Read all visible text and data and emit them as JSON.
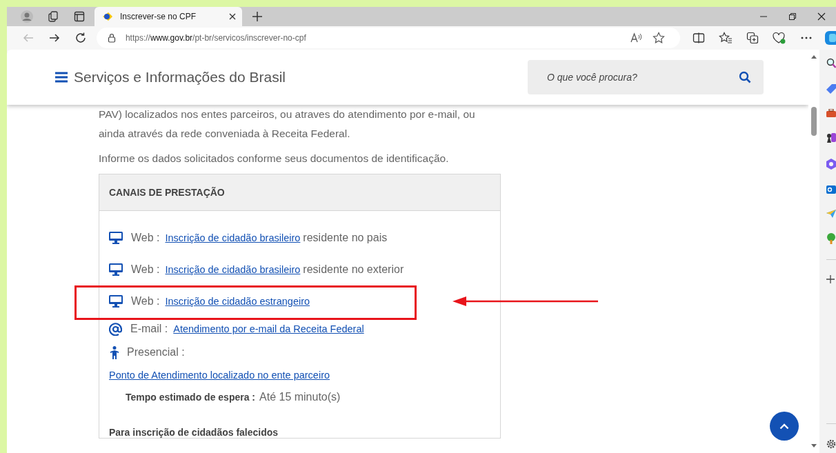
{
  "browser": {
    "tabs": [
      {
        "title": "Inscrever-se no CPF",
        "selected": true
      }
    ],
    "url": {
      "scheme": "https://",
      "host": "www.gov.br",
      "path": "/pt-br/servicos/inscrever-no-cpf"
    }
  },
  "header": {
    "title": "Serviços e Informações do Brasil",
    "search": {
      "placeholder": "O que você procura?"
    }
  },
  "paragraphs": [
    "PAV) localizados nos entes parceiros, ou atraves do atendimento por e-mail, ou ainda através da rede conveniada à Receita Federal.",
    "Informe os dados solicitados conforme seus documentos de identificação."
  ],
  "card": {
    "title": "CANAIS DE PRESTAÇÃO",
    "channels": [
      {
        "kind": "web",
        "label": "Web :",
        "link": "Inscrição de cidadão brasileiro",
        "suffix": "residente no pais"
      },
      {
        "kind": "web",
        "label": "Web :",
        "link": "Inscrição de cidadão brasileiro",
        "suffix": "residente no exterior"
      },
      {
        "kind": "web",
        "label": "Web :",
        "link": "Inscrição de cidadão estrangeiro",
        "annotation": {
          "kind": "frame_with_arrow"
        }
      },
      {
        "kind": "email",
        "label": "E-mail :",
        "link": "Atendimento por e-mail da Receita Federal"
      },
      {
        "kind": "person",
        "label": "Presencial :"
      }
    ],
    "in_person_link": "Ponto de Atendimento localizado no ente parceiro",
    "wait": {
      "label": "Tempo estimado de espera :",
      "value": "Até 15 minuto(s)"
    },
    "footer_heading": "Para inscrição de cidadãos falecidos"
  }
}
